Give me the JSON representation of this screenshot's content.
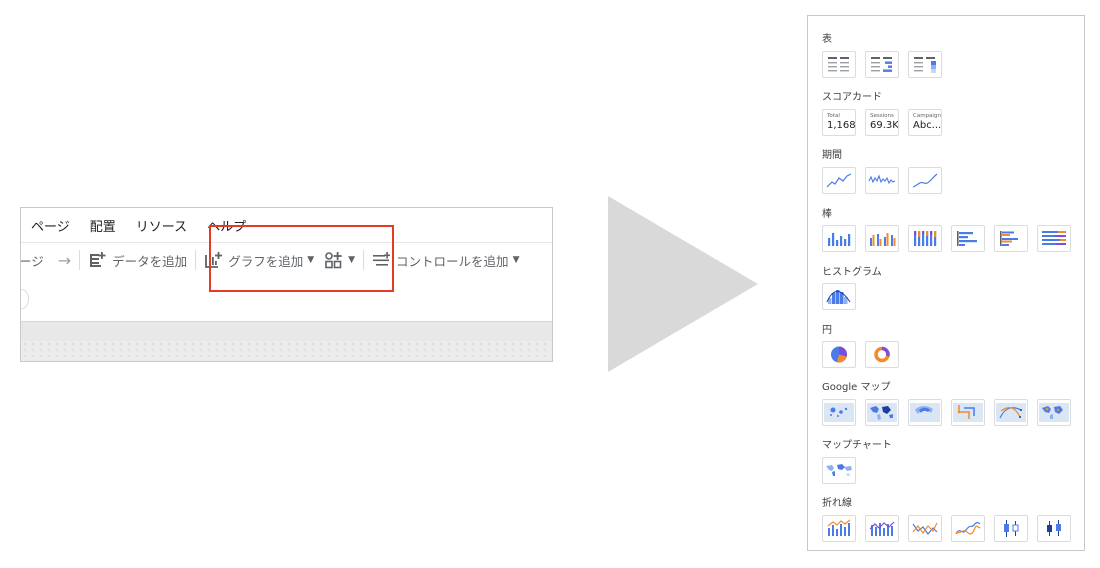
{
  "toolbar": {
    "menu": [
      "ページ",
      "配置",
      "リソース",
      "ヘルプ"
    ],
    "partial_label": "ージ",
    "add_data_label": "データを追加",
    "add_chart_label": "グラフを追加",
    "add_control_label": "コントロールを追加"
  },
  "chart_picker": {
    "sections": {
      "table": "表",
      "scorecard": "スコアカード",
      "timeseries": "期間",
      "bar": "棒",
      "histogram": "ヒストグラム",
      "pie": "円",
      "google_maps": "Google マップ",
      "map_chart": "マップチャート",
      "line": "折れ線"
    },
    "scorecards": [
      {
        "label": "Total",
        "value": "1,168"
      },
      {
        "label": "Sessions",
        "value": "69.3K"
      },
      {
        "label": "Campaign",
        "value": "Abc..."
      }
    ]
  },
  "colors": {
    "highlight": "#e53b24",
    "chart_blue": "#4a7be8",
    "chart_orange": "#f28b2b",
    "chart_purple": "#7b4dde",
    "arrow": "#d9d9d9"
  }
}
